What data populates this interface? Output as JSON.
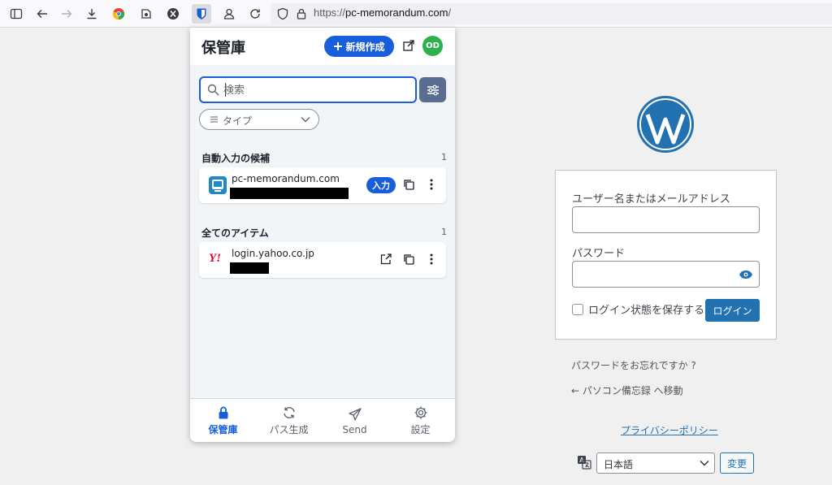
{
  "browser": {
    "url_proto": "https://",
    "url_host": "pc-memorandum.com",
    "url_path": "/",
    "toolbar_icons": [
      "sidebar-icon",
      "back-icon",
      "forward-icon",
      "download-icon",
      "chrome-extension-icon",
      "extension-icon",
      "x-extension-icon",
      "bitwarden-icon",
      "account-icon",
      "reload-icon",
      "shield-icon",
      "lock-icon"
    ]
  },
  "popup": {
    "title": "保管庫",
    "new_button": "新規作成",
    "avatar": "OD",
    "search_placeholder": "検索",
    "type_filter": "タイプ",
    "autofill_section": {
      "title": "自動入力の候補",
      "count": "1"
    },
    "autofill_items": [
      {
        "name": "pc-memorandum.com",
        "fill_label": "入力"
      }
    ],
    "all_section": {
      "title": "全てのアイテム",
      "count": "1"
    },
    "all_items": [
      {
        "name": "login.yahoo.co.jp",
        "favicon_text": "Y!"
      }
    ],
    "nav": [
      {
        "label": "保管庫",
        "icon": "lock-icon",
        "active": true
      },
      {
        "label": "パス生成",
        "icon": "sync-icon",
        "active": false
      },
      {
        "label": "Send",
        "icon": "send-icon",
        "active": false
      },
      {
        "label": "設定",
        "icon": "gear-icon",
        "active": false
      }
    ]
  },
  "login": {
    "username_label": "ユーザー名またはメールアドレス",
    "password_label": "パスワード",
    "remember_label": "ログイン状態を保存する",
    "login_button": "ログイン",
    "lost_password": "パスワードをお忘れですか ?",
    "back_link": "← パソコン備忘録 へ移動",
    "privacy": "プライバシーポリシー",
    "language": "日本語",
    "change_button": "変更"
  },
  "colors": {
    "accent": "#175ddc",
    "wp_blue": "#2271b1",
    "avatar": "#2eb04d"
  }
}
